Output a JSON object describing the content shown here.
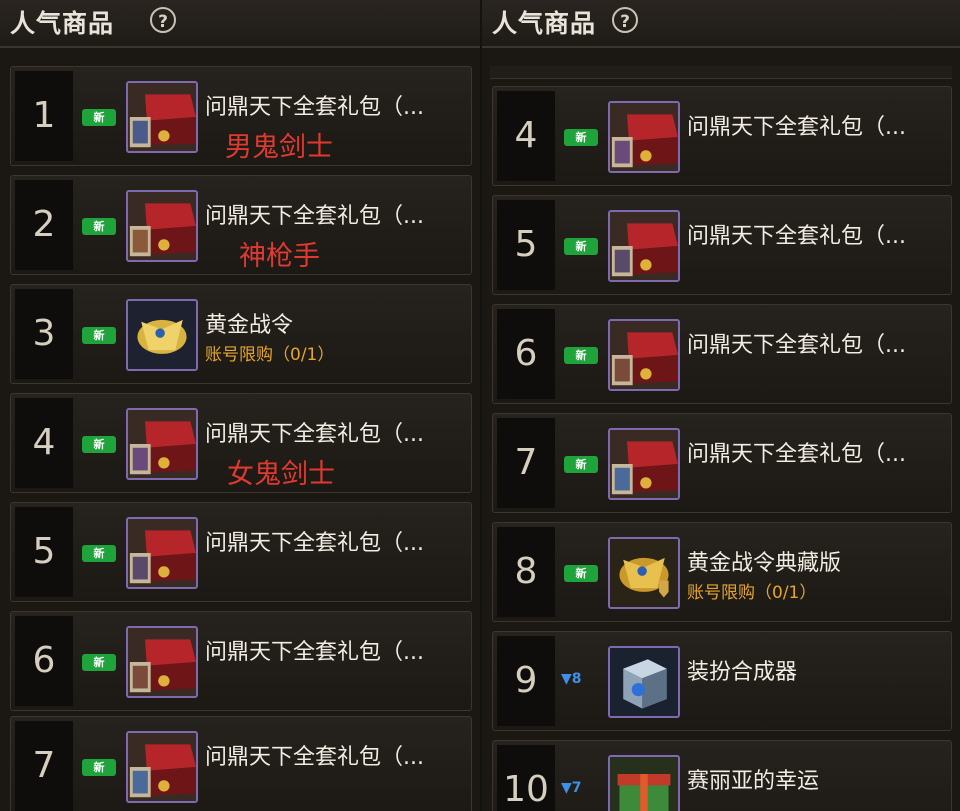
{
  "colors": {
    "background": "#1b1814",
    "new_badge": "#1fa43c",
    "limit_text": "#e5a52a",
    "trend_down": "#3f8fe6",
    "annotation": "#e03a30"
  },
  "left_panel": {
    "title": "人气商品",
    "help_icon": "?",
    "items": [
      {
        "rank": "1",
        "badge": "新",
        "icon": "gift-box-icon",
        "name": "问鼎天下全套礼包（...",
        "annotation": "男鬼剑士"
      },
      {
        "rank": "2",
        "badge": "新",
        "icon": "gift-box-icon",
        "name": "问鼎天下全套礼包（...",
        "annotation": "神枪手"
      },
      {
        "rank": "3",
        "badge": "新",
        "icon": "golden-battle-order-icon",
        "name": "黄金战令",
        "limit": "账号限购（0/1）"
      },
      {
        "rank": "4",
        "badge": "新",
        "icon": "gift-box-icon",
        "name": "问鼎天下全套礼包（...",
        "annotation": "女鬼剑士"
      },
      {
        "rank": "5",
        "badge": "新",
        "icon": "gift-box-icon",
        "name": "问鼎天下全套礼包（..."
      },
      {
        "rank": "6",
        "badge": "新",
        "icon": "gift-box-icon",
        "name": "问鼎天下全套礼包（..."
      },
      {
        "rank": "7",
        "badge": "新",
        "icon": "gift-box-icon",
        "name": "问鼎天下全套礼包（..."
      }
    ]
  },
  "right_panel": {
    "title": "人气商品",
    "help_icon": "?",
    "items": [
      {
        "rank": "4",
        "badge": "新",
        "icon": "gift-box-icon",
        "name": "问鼎天下全套礼包（..."
      },
      {
        "rank": "5",
        "badge": "新",
        "icon": "gift-box-icon",
        "name": "问鼎天下全套礼包（..."
      },
      {
        "rank": "6",
        "badge": "新",
        "icon": "gift-box-icon",
        "name": "问鼎天下全套礼包（..."
      },
      {
        "rank": "7",
        "badge": "新",
        "icon": "gift-box-icon",
        "name": "问鼎天下全套礼包（..."
      },
      {
        "rank": "8",
        "badge": "新",
        "icon": "golden-battle-order-icon",
        "name": "黄金战令典藏版",
        "limit": "账号限购（0/1）"
      },
      {
        "rank": "9",
        "trend": "▼8",
        "icon": "costume-synthesizer-icon",
        "name": "装扮合成器"
      },
      {
        "rank": "10",
        "trend": "▼7",
        "icon": "seria-luck-gift-icon",
        "name": "赛丽亚的幸运"
      }
    ]
  }
}
